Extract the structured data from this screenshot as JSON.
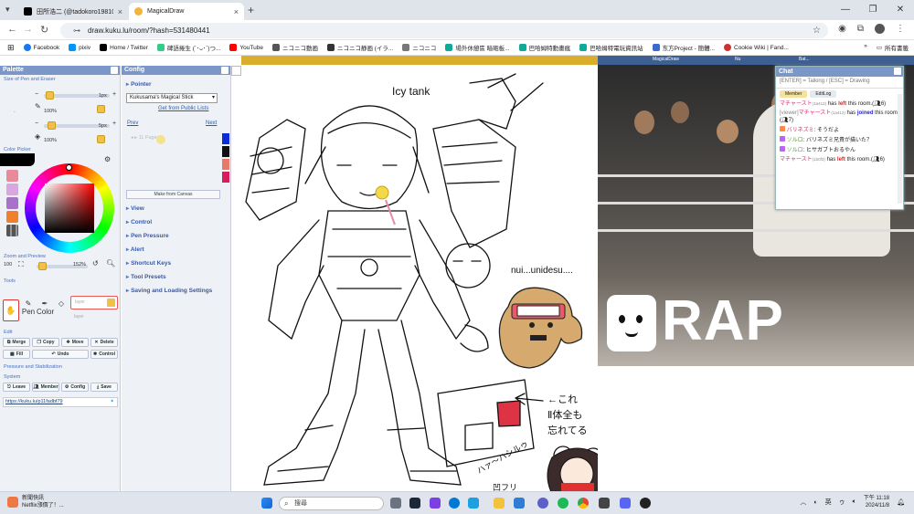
{
  "browser": {
    "tabs": [
      {
        "title": "田所浩二 (@tadokoro19810) / X",
        "close": "×"
      },
      {
        "title": "MagicalDraw",
        "close": "×"
      }
    ],
    "new_tab": "+",
    "window_controls": [
      "—",
      "❐",
      "✕"
    ],
    "url": "draw.kuku.lu/room/?hash=531480441",
    "bookmarks": [
      "Facebook",
      "pixiv",
      "Home / Twitter",
      "碑語捲生 (´･ᴗ･`)つ...",
      "YouTube",
      "ニコニコ動画",
      "ニコニコ静画 (イラ...",
      "ニコニコ",
      "場外休憩區 暗砲板...",
      "巴哈姆特動畫瘋",
      "巴哈姆特電玩資訊站",
      "东方Project - 簡體...",
      "Cookie Wiki | Fand..."
    ],
    "bookmarks_more": "»",
    "all_bookmarks": "所有書籤"
  },
  "palette": {
    "title": "Palette",
    "size_section": "Size of Pen and Eraser",
    "pen_size": "1px",
    "pen_opacity": "100%",
    "eraser_size": "5px",
    "eraser_opacity": "100%",
    "color_section": "Color Picker",
    "zoom_section": "Zoom and Preview",
    "zoom_value": "152%",
    "zoom_fit": "100",
    "tools_section": "Tools",
    "tool_pen": "Pen",
    "tool_color": "Color",
    "layer1": "layer",
    "layer2": "layer",
    "edit_section": "Edit",
    "edit_buttons": [
      "Merge",
      "Copy",
      "Move",
      "Delete",
      "Fill",
      "Undo",
      "Control"
    ],
    "pressure_section": "Pressure and Stabilization",
    "system_section": "System",
    "system_buttons": [
      "Leave",
      "Member",
      "Config",
      "Save"
    ],
    "room_link": "https://kuku.lu/p11fadbf79",
    "swatches": [
      "#e88a9a",
      "#d8a6e0",
      "#a872c8",
      "#f08030",
      "#222222"
    ]
  },
  "config": {
    "title": "Config",
    "pointer": "Pointer",
    "stick_select": "Kukusama's Magical Stick",
    "get_public": "Get from Public Lists",
    "prev": "Prev",
    "next": "Next",
    "pages": "11 Pages",
    "make_canvas": "Make from Canvas",
    "items": [
      "View",
      "Control",
      "Pen Pressure",
      "Alert",
      "Shortcut Keys",
      "Tool Presets",
      "Saving and Loading Settings"
    ],
    "colors": [
      "#0a2bd6",
      "#111111",
      "#e87a6a",
      "#d81e5a"
    ]
  },
  "chat": {
    "title": "Chat",
    "hint": "[ENTER] = Talking / [ESC] = Drawing",
    "tabs": [
      "Member",
      "EditLog"
    ],
    "messages": [
      {
        "user": "マチャースト",
        "id": "(1a412)",
        "pre": " has ",
        "action": "left",
        "post": " this room.(",
        "count": "6)"
      },
      {
        "pre_label": "[viewer]",
        "user": "マチャースト",
        "id": "(1a412)",
        "pre": " has ",
        "action": "joined",
        "post": " this room.(",
        "count": "7)"
      },
      {
        "user": "バリネズミ",
        "text": ": そうだよ"
      },
      {
        "user": "ソルロ",
        "text": ": バリネズミ兄貴が描いた？"
      },
      {
        "user": "ソルロ",
        "text": ": ヒサガブトおるやん"
      },
      {
        "user": "マチャースト",
        "id": "(1b0f3)",
        "pre": " has ",
        "action": "left",
        "post": " this room.(",
        "count": "6)"
      }
    ]
  },
  "canvas": {
    "label_tank": "Icy tank",
    "label_nui": "nui...unidesu....",
    "label_note1": "←これ",
    "label_note2": "Ⅱ体全も",
    "label_note3": "忘れてる",
    "label_scribble": "ハァ〜ハシルゥ",
    "label_bottom": "凹フリ",
    "video_text": "RAP",
    "strip_items": [
      "MagicalDraw",
      "Nu",
      "Bat..."
    ]
  },
  "taskbar": {
    "news_title": "新聞快訊",
    "news_text": "Netflix漲價了！...",
    "search_placeholder": "搜尋",
    "ime_lang": "英",
    "time": "下午 11:18",
    "date": "2024/11/8"
  }
}
